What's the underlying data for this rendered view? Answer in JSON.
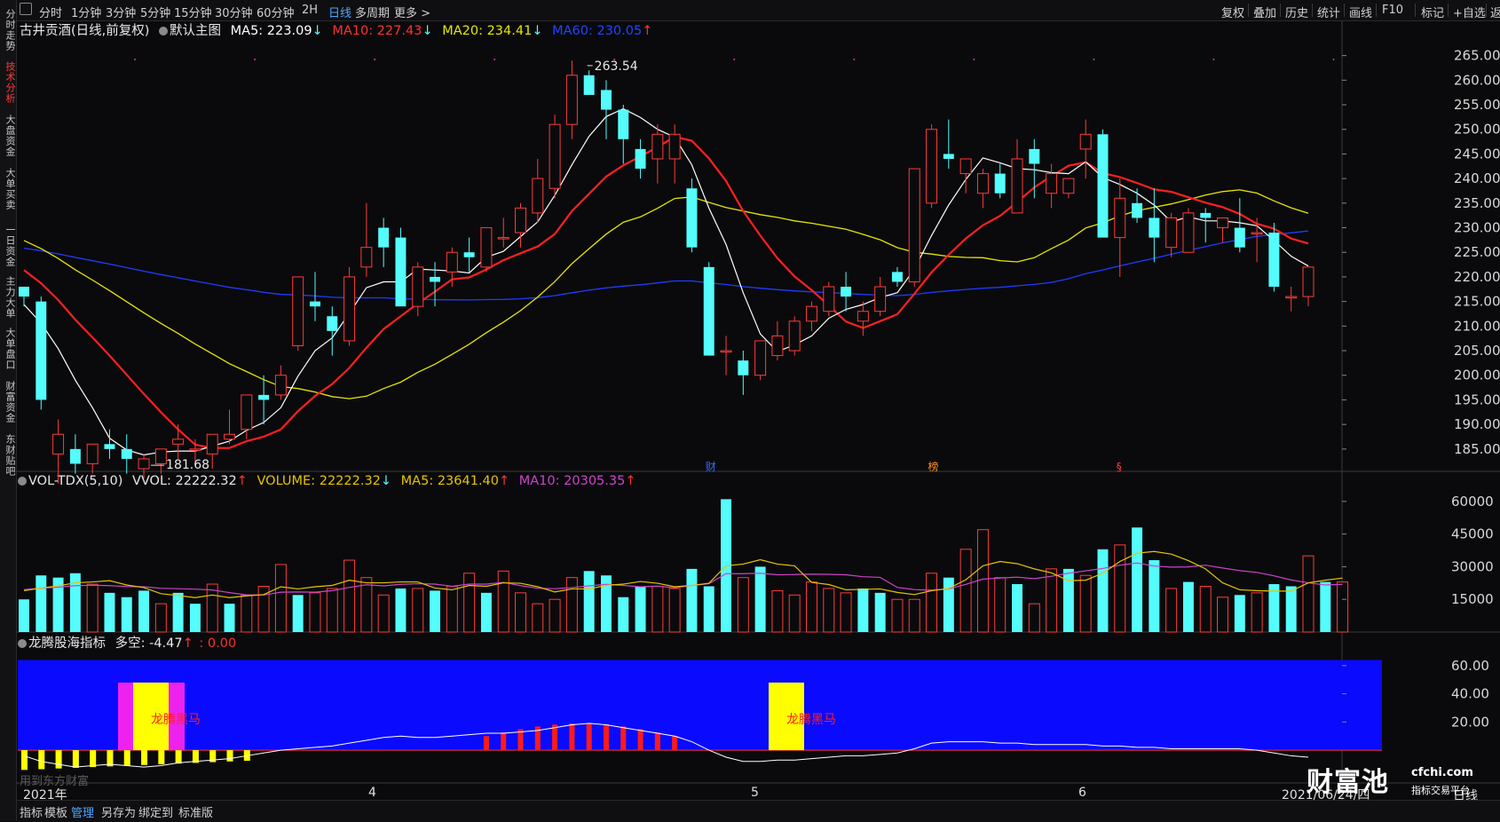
{
  "sidebar": {
    "items": [
      {
        "label": "分时走势",
        "active": false
      },
      {
        "label": "技术分析",
        "active": true
      },
      {
        "label": "大盘资金",
        "active": false
      },
      {
        "label": "大单买卖",
        "active": false
      },
      {
        "label": "一日资金",
        "active": false
      },
      {
        "label": "主力大单",
        "active": false
      },
      {
        "label": "大单盘口",
        "active": false
      },
      {
        "label": "财富资金",
        "active": false
      },
      {
        "label": "东财贴吧",
        "active": false
      }
    ]
  },
  "toolbar": {
    "periods": [
      "分时",
      "1分钟",
      "3分钟",
      "5分钟",
      "15分钟",
      "30分钟",
      "60分钟",
      "2H",
      "日线",
      "多周期",
      "更多 >"
    ],
    "active_period": "日线",
    "right_items": [
      "复权",
      "叠加",
      "历史",
      "统计",
      "画线",
      "F10",
      "标记",
      "+自选",
      "返回"
    ]
  },
  "main_header": {
    "stock": "古井贡酒(日线,前复权)",
    "main_label": "默认主图",
    "ma5": "MA5: 223.09",
    "ma5_arrow": "↓",
    "ma10": "MA10: 227.43",
    "ma10_arrow": "↓",
    "ma20": "MA20: 234.41",
    "ma20_arrow": "↓",
    "ma60": "MA60: 230.05",
    "ma60_arrow": "↑"
  },
  "vol_header": {
    "name": "VOL-TDX(5,10)",
    "vvol": "VVOL: 22222.32",
    "vvol_arrow": "↑",
    "volume": "VOLUME: 22222.32",
    "volume_arrow": "↓",
    "ma5": "MA5: 23641.40",
    "ma5_arrow": "↑",
    "ma10": "MA10: 20305.35",
    "ma10_arrow": "↑"
  },
  "ind_header": {
    "name": "龙腾股海指标",
    "duokong": "多空: -4.47",
    "duokong_arrow": "↑",
    "extra": ": 0.00"
  },
  "chart_data": [
    {
      "type": "candlestick",
      "title": "古井贡酒(日线,前复权)",
      "y_ticks": [
        "265.00",
        "260.00",
        "255.00",
        "250.00",
        "245.00",
        "240.00",
        "235.00",
        "230.00",
        "225.00",
        "220.00",
        "215.00",
        "210.00",
        "205.00",
        "200.00",
        "195.00",
        "190.00",
        "185.00"
      ],
      "ylim": [
        181,
        268
      ],
      "annotations": {
        "high": "263.54",
        "low": "181.68"
      },
      "event_markers": [
        "财",
        "榜",
        "§"
      ],
      "candles": [
        [
          218,
          218,
          214,
          216
        ],
        [
          215,
          216,
          193,
          195
        ],
        [
          184,
          191,
          178,
          188
        ],
        [
          185,
          188,
          180,
          182
        ],
        [
          182,
          186,
          180,
          186
        ],
        [
          186,
          189,
          183,
          185
        ],
        [
          185,
          188,
          180,
          183
        ],
        [
          181,
          184,
          179,
          183
        ],
        [
          182,
          185,
          180,
          185
        ],
        [
          186,
          190,
          183,
          187
        ],
        [
          185,
          187,
          182,
          185
        ],
        [
          184,
          188,
          181,
          188
        ],
        [
          187,
          193,
          186,
          188
        ],
        [
          189,
          196,
          187,
          196
        ],
        [
          196,
          200,
          190,
          195
        ],
        [
          196,
          202,
          195,
          200
        ],
        [
          206,
          220,
          205,
          220
        ],
        [
          215,
          221,
          211,
          214
        ],
        [
          212,
          214,
          204,
          209
        ],
        [
          207,
          222,
          206,
          220
        ],
        [
          222,
          235,
          220,
          226
        ],
        [
          230,
          232,
          222,
          226
        ],
        [
          228,
          230,
          215,
          214
        ],
        [
          214,
          223,
          212,
          222
        ],
        [
          220,
          223,
          214,
          219
        ],
        [
          221,
          226,
          218,
          225
        ],
        [
          225,
          228,
          221,
          224
        ],
        [
          222,
          230,
          221,
          230
        ],
        [
          228,
          232,
          226,
          228
        ],
        [
          229,
          235,
          226,
          234
        ],
        [
          233,
          244,
          231,
          240
        ],
        [
          238,
          253,
          236,
          251
        ],
        [
          251,
          264,
          248,
          261
        ],
        [
          261,
          262,
          257,
          257
        ],
        [
          258,
          260,
          248,
          254
        ],
        [
          254,
          255,
          243,
          248
        ],
        [
          246,
          248,
          240,
          242
        ],
        [
          244,
          251,
          239,
          249
        ],
        [
          244,
          251,
          239,
          249
        ],
        [
          238,
          240,
          225,
          226
        ],
        [
          222,
          223,
          204,
          204
        ],
        [
          205,
          208,
          200,
          205
        ],
        [
          203,
          205,
          196,
          200
        ],
        [
          200,
          207,
          199,
          207
        ],
        [
          204,
          211,
          203,
          208
        ],
        [
          205,
          212,
          204,
          211
        ],
        [
          211,
          215,
          209,
          214
        ],
        [
          213,
          219,
          212,
          218
        ],
        [
          218,
          221,
          213,
          216
        ],
        [
          211,
          215,
          208,
          213
        ],
        [
          213,
          220,
          212,
          218
        ],
        [
          221,
          222,
          218,
          219
        ],
        [
          219,
          242,
          218,
          242
        ],
        [
          235,
          251,
          234,
          250
        ],
        [
          245,
          252,
          242,
          244
        ],
        [
          241,
          244,
          237,
          244
        ],
        [
          237,
          242,
          234,
          241
        ],
        [
          241,
          243,
          236,
          237
        ],
        [
          233,
          248,
          233,
          244
        ],
        [
          246,
          248,
          236,
          243
        ],
        [
          237,
          243,
          234,
          241
        ],
        [
          237,
          240,
          236,
          240
        ],
        [
          246,
          252,
          240,
          249
        ],
        [
          249,
          250,
          238,
          228
        ],
        [
          228,
          240,
          220,
          236
        ],
        [
          235,
          238,
          231,
          232
        ],
        [
          232,
          238,
          223,
          228
        ],
        [
          226,
          233,
          224,
          232
        ],
        [
          225,
          234,
          225,
          233
        ],
        [
          233,
          234,
          227,
          232
        ],
        [
          230,
          232,
          227,
          232
        ],
        [
          230,
          236,
          225,
          226
        ],
        [
          229,
          232,
          223,
          229
        ],
        [
          229,
          231,
          217,
          218
        ],
        [
          216,
          218,
          213,
          216
        ],
        [
          216,
          222,
          214,
          222
        ]
      ]
    },
    {
      "type": "bar",
      "title": "VOL-TDX(5,10)",
      "y_ticks": [
        "60000",
        "45000",
        "30000",
        "15000"
      ],
      "ylim": [
        0,
        64000
      ],
      "values": [
        15000,
        26000,
        25000,
        27000,
        22000,
        18000,
        16000,
        19000,
        13000,
        18000,
        13000,
        22000,
        13000,
        17000,
        21000,
        31000,
        17000,
        18000,
        20000,
        33000,
        25000,
        17000,
        20000,
        20000,
        19000,
        21000,
        27000,
        18000,
        28000,
        18000,
        13000,
        15000,
        25000,
        28000,
        26000,
        16000,
        21000,
        21000,
        20000,
        29000,
        21000,
        61000,
        25000,
        30000,
        19000,
        17000,
        23000,
        20000,
        18000,
        20000,
        18000,
        15000,
        15000,
        27000,
        25000,
        38000,
        47000,
        25000,
        22000,
        13000,
        29000,
        29000,
        26000,
        38000,
        40000,
        48000,
        33000,
        20000,
        23000,
        21000,
        16000,
        17000,
        18000,
        22000,
        21000,
        35000,
        23000,
        23000
      ],
      "colors_up": [
        false,
        false,
        false,
        false,
        true,
        false,
        false,
        false,
        true,
        false,
        false,
        true,
        false,
        true,
        true,
        true,
        false,
        true,
        true,
        true,
        true,
        true,
        false,
        true,
        false,
        true,
        true,
        false,
        true,
        true,
        true,
        true,
        true,
        false,
        false,
        false,
        false,
        true,
        true,
        false,
        false,
        false,
        true,
        false,
        true,
        true,
        true,
        true,
        true,
        false,
        false,
        true,
        true,
        true,
        false,
        true,
        true,
        true,
        false,
        true,
        true,
        false,
        true,
        false,
        true,
        false,
        false,
        true,
        false,
        true,
        true,
        false,
        true,
        false,
        false,
        true,
        false,
        true
      ]
    },
    {
      "type": "area",
      "title": "龙腾股海指标",
      "y_ticks": [
        "60.00",
        "40.00",
        "20.00"
      ],
      "ylim": [
        -22,
        70
      ],
      "bands": [
        {
          "label": "龙腾黑马"
        },
        {
          "label": "龙腾黑马"
        }
      ]
    }
  ],
  "x_axis": {
    "labels": [
      "2021年",
      "4",
      "5",
      "6",
      "2021/06/24/四"
    ]
  },
  "right_badge": "日线",
  "watermark": "用到东方财富",
  "logo": {
    "main": "财富池",
    "site": "cfchi.com",
    "tagline": "指标交易平台"
  },
  "bottombar": {
    "items": [
      "指标",
      "模板",
      "管理",
      "另存为",
      "绑定到",
      "标准版"
    ],
    "active": "管理"
  },
  "colors": {
    "up": "#ff3b3b",
    "down": "#54fcfc",
    "ma5": "#ffffff",
    "ma10": "#ff2020",
    "ma20": "#e6e600",
    "ma60": "#1f3cff",
    "vol_ma5": "#e6c400",
    "vol_ma10": "#cc44cc",
    "ind_bg": "#0a0aff"
  }
}
